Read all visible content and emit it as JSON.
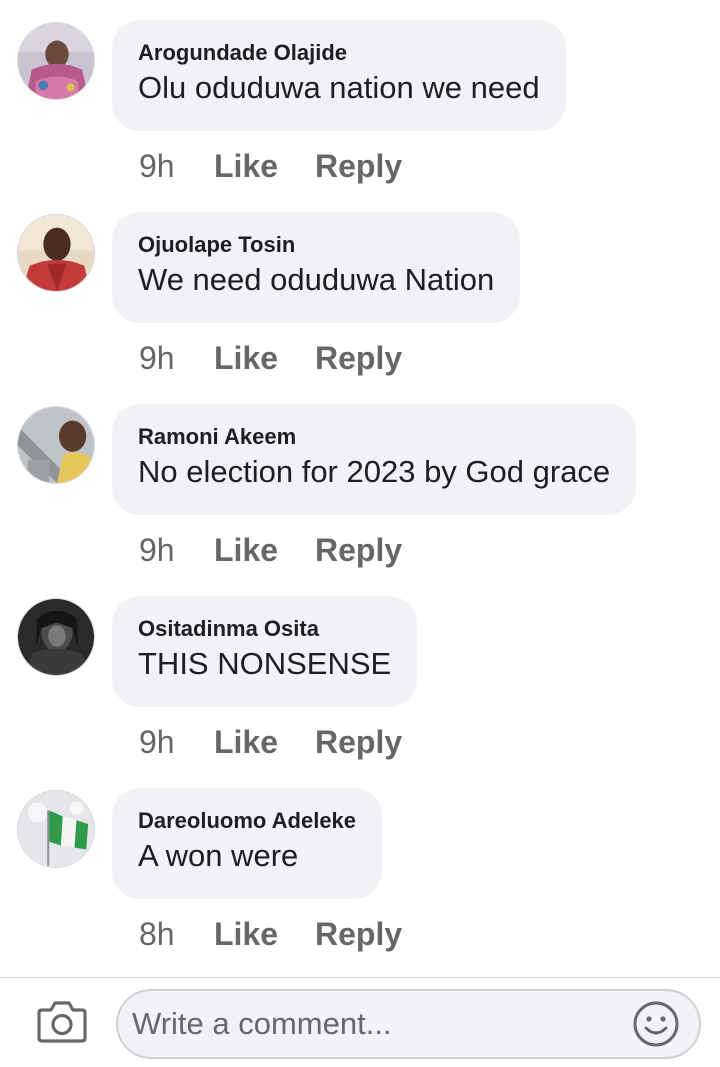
{
  "comments": [
    {
      "author": "Arogundade Olajide",
      "text": "Olu oduduwa nation we need",
      "time": "9h",
      "like_label": "Like",
      "reply_label": "Reply",
      "avatar_icon": "profile-photo"
    },
    {
      "author": "Ojuolape Tosin",
      "text": "We need oduduwa Nation",
      "time": "9h",
      "like_label": "Like",
      "reply_label": "Reply",
      "avatar_icon": "profile-photo"
    },
    {
      "author": "Ramoni Akeem",
      "text": "No election for 2023 by God grace",
      "time": "9h",
      "like_label": "Like",
      "reply_label": "Reply",
      "avatar_icon": "profile-photo"
    },
    {
      "author": "Ositadinma Osita",
      "text": "THIS NONSENSE",
      "time": "9h",
      "like_label": "Like",
      "reply_label": "Reply",
      "avatar_icon": "profile-photo"
    },
    {
      "author": "Dareoluomo Adeleke",
      "text": "A won were",
      "time": "8h",
      "like_label": "Like",
      "reply_label": "Reply",
      "avatar_icon": "profile-photo"
    }
  ],
  "composer": {
    "placeholder": "Write a comment...",
    "camera_icon": "camera-icon",
    "emoji_icon": "smiley-icon"
  },
  "colors": {
    "bubble_background": "#f0f2f5",
    "primary_text": "#1c1e21",
    "secondary_text": "#65676b"
  }
}
